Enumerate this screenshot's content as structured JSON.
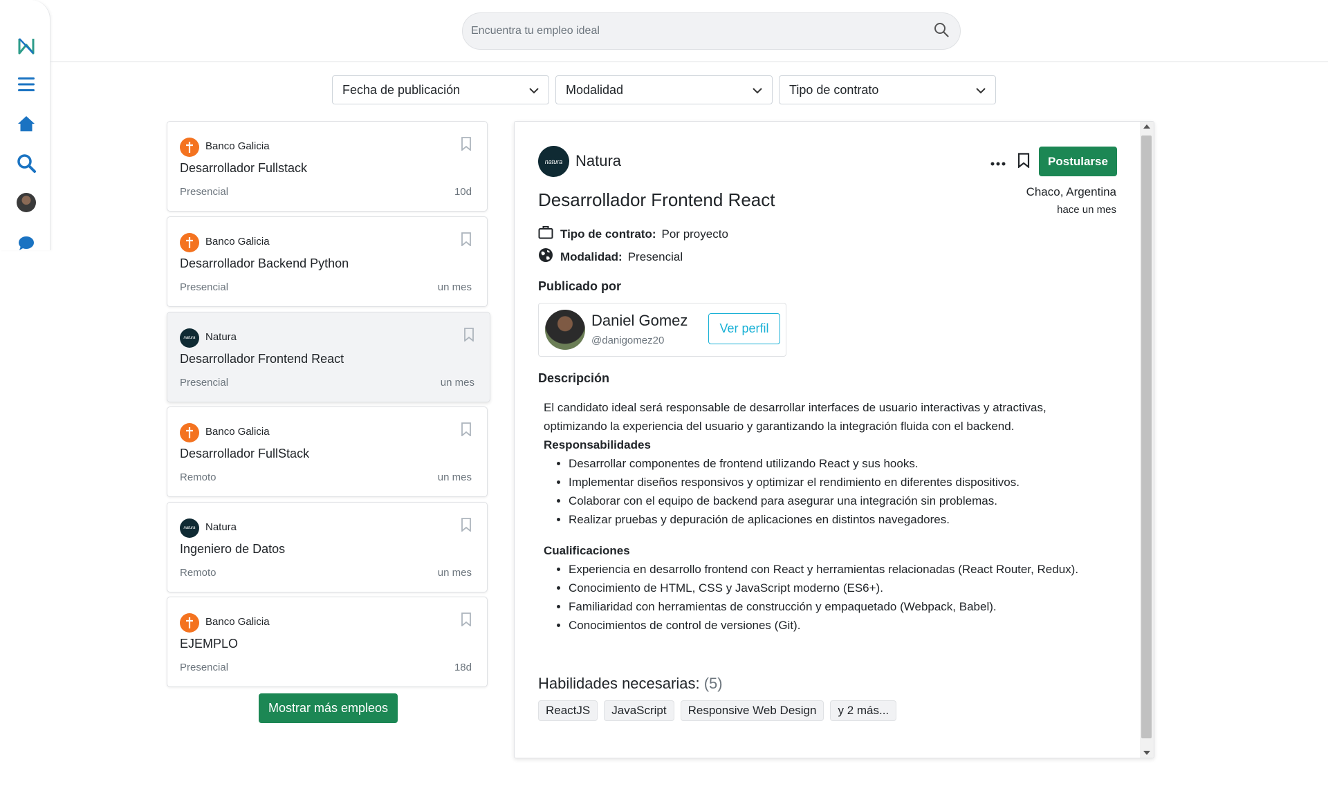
{
  "sidebar": {
    "icons": [
      "logo-icon",
      "menu-icon",
      "home-icon",
      "search-icon",
      "avatar",
      "chat-icon"
    ]
  },
  "search": {
    "placeholder": "Encuentra tu empleo ideal"
  },
  "filters": [
    {
      "label": "Fecha de publicación"
    },
    {
      "label": "Modalidad"
    },
    {
      "label": "Tipo de contrato"
    }
  ],
  "jobs": [
    {
      "company": "Banco Galicia",
      "title": "Desarrollador Fullstack",
      "modality": "Presencial",
      "time": "10d"
    },
    {
      "company": "Banco Galicia",
      "title": "Desarrollador Backend Python",
      "modality": "Presencial",
      "time": "un mes"
    },
    {
      "company": "Natura",
      "title": "Desarrollador Frontend React",
      "modality": "Presencial",
      "time": "un mes"
    },
    {
      "company": "Banco Galicia",
      "title": "Desarrollador FullStack",
      "modality": "Remoto",
      "time": "un mes"
    },
    {
      "company": "Natura",
      "title": "Ingeniero de Datos",
      "modality": "Remoto",
      "time": "un mes"
    },
    {
      "company": "Banco Galicia",
      "title": "EJEMPLO",
      "modality": "Presencial",
      "time": "18d"
    }
  ],
  "more_button": "Mostrar más empleos",
  "detail": {
    "company": "Natura",
    "logo_text": "natura",
    "apply": "Postularse",
    "location": "Chaco, Argentina",
    "posted": "hace un mes",
    "title": "Desarrollador Frontend React",
    "contract_label": "Tipo de contrato:",
    "contract_value": "Por proyecto",
    "modality_label": "Modalidad:",
    "modality_value": "Presencial",
    "published_by": "Publicado por",
    "author": {
      "name": "Daniel Gomez",
      "handle": "@danigomez20",
      "profile_button": "Ver perfil"
    },
    "description_heading": "Descripción",
    "intro_1": "El candidato ideal será responsable de desarrollar interfaces de usuario interactivas y atractivas,",
    "intro_2": "optimizando la experiencia del usuario y garantizando la integración fluida con el backend.",
    "responsibilities_heading": "Responsabilidades",
    "responsibilities": [
      "Desarrollar componentes de frontend utilizando React y sus hooks.",
      "Implementar diseños responsivos y optimizar el rendimiento en diferentes dispositivos.",
      "Colaborar con el equipo de backend para asegurar una integración sin problemas.",
      "Realizar pruebas y depuración de aplicaciones en distintos navegadores."
    ],
    "qualifications_heading": "Cualificaciones",
    "qualifications": [
      "Experiencia en desarrollo frontend con React y herramientas relacionadas (React Router, Redux).",
      "Conocimiento de HTML, CSS y JavaScript moderno (ES6+).",
      "Familiaridad con herramientas de construcción y empaquetado (Webpack, Babel).",
      "Conocimientos de control de versiones (Git)."
    ],
    "skills_heading": "Habilidades necesarias:",
    "skills_count": "(5)",
    "skills": [
      "ReactJS",
      "JavaScript",
      "Responsive Web Design",
      "y 2 más..."
    ]
  },
  "colors": {
    "primary": "#1c8754",
    "accent": "#1ab1d6",
    "icon_blue": "#1a73c2",
    "galicia": "#f47320",
    "natura": "#0f2a33"
  }
}
